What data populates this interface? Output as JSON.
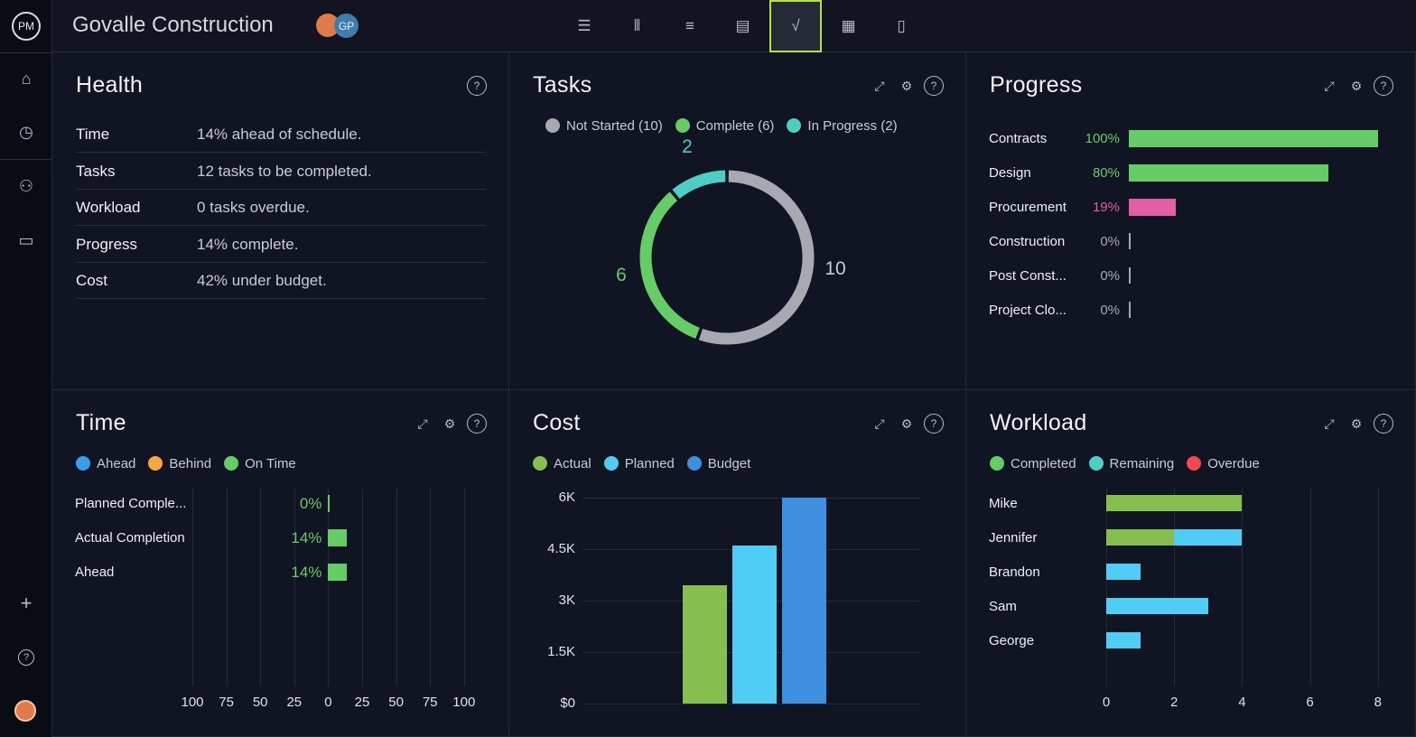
{
  "app": {
    "logo": "PM",
    "project_title": "Govalle Construction",
    "avatar_initials": "GP"
  },
  "toolbar": {
    "views": [
      {
        "icon": "list-icon"
      },
      {
        "icon": "board-icon"
      },
      {
        "icon": "gantt-icon"
      },
      {
        "icon": "sheet-icon"
      },
      {
        "icon": "dashboard-icon",
        "active": true
      },
      {
        "icon": "calendar-icon"
      },
      {
        "icon": "file-icon"
      }
    ],
    "accent": "#b4e33d"
  },
  "sidebar": {
    "items": [
      "home-icon",
      "clock-icon",
      "people-icon",
      "briefcase-icon"
    ],
    "bottom": [
      "plus-icon",
      "help-icon",
      "user-avatar"
    ]
  },
  "health": {
    "title": "Health",
    "rows": [
      {
        "label": "Time",
        "value": "14% ahead of schedule."
      },
      {
        "label": "Tasks",
        "value": "12 tasks to be completed."
      },
      {
        "label": "Workload",
        "value": "0 tasks overdue."
      },
      {
        "label": "Progress",
        "value": "14% complete."
      },
      {
        "label": "Cost",
        "value": "42% under budget."
      }
    ]
  },
  "tasks": {
    "title": "Tasks"
  },
  "progress": {
    "title": "Progress"
  },
  "time": {
    "title": "Time"
  },
  "cost": {
    "title": "Cost"
  },
  "workload": {
    "title": "Workload"
  },
  "chart_data": [
    {
      "id": "tasks",
      "type": "pie",
      "donut": true,
      "legend": [
        {
          "label": "Not Started (10)",
          "color": "#a6a9b1"
        },
        {
          "label": "Complete (6)",
          "color": "#66cc66"
        },
        {
          "label": "In Progress (2)",
          "color": "#4ecdc4"
        }
      ],
      "slices": [
        {
          "name": "Not Started",
          "value": 10,
          "label": "10",
          "color": "#a6a9b1"
        },
        {
          "name": "Complete",
          "value": 6,
          "label": "6",
          "color": "#66cc66"
        },
        {
          "name": "In Progress",
          "value": 2,
          "label": "2",
          "color": "#4ecdc4"
        }
      ]
    },
    {
      "id": "progress",
      "type": "bar",
      "orientation": "horizontal",
      "xlim": [
        0,
        100
      ],
      "categories": [
        "Contracts",
        "Design",
        "Procurement",
        "Construction",
        "Post Const...",
        "Project Clo..."
      ],
      "values": [
        100,
        80,
        19,
        0,
        0,
        0
      ],
      "value_labels": [
        "100%",
        "80%",
        "19%",
        "0%",
        "0%",
        "0%"
      ],
      "colors": [
        "#66cc66",
        "#66cc66",
        "#e35ea6",
        "#a6a9b1",
        "#a6a9b1",
        "#a6a9b1"
      ]
    },
    {
      "id": "time",
      "type": "bar",
      "orientation": "horizontal",
      "diverging": true,
      "xlim": [
        -100,
        100
      ],
      "legend": [
        {
          "label": "Ahead",
          "color": "#3b9eea"
        },
        {
          "label": "Behind",
          "color": "#f5a742"
        },
        {
          "label": "On Time",
          "color": "#66cc66"
        }
      ],
      "categories": [
        "Planned Comple...",
        "Actual Completion",
        "Ahead"
      ],
      "values": [
        0,
        14,
        14
      ],
      "value_labels": [
        "0%",
        "14%",
        "14%"
      ],
      "color": "#66cc66",
      "xticks": [
        "100",
        "75",
        "50",
        "25",
        "0",
        "25",
        "50",
        "75",
        "100"
      ],
      "grid": true
    },
    {
      "id": "cost",
      "type": "bar",
      "ylim": [
        0,
        6000
      ],
      "legend": [
        {
          "label": "Actual",
          "color": "#86bf50"
        },
        {
          "label": "Planned",
          "color": "#4fcdf5"
        },
        {
          "label": "Budget",
          "color": "#3f8fe0"
        }
      ],
      "series": [
        {
          "name": "Actual",
          "values": [
            3450
          ],
          "color": "#86bf50"
        },
        {
          "name": "Planned",
          "values": [
            4600
          ],
          "color": "#4fcdf5"
        },
        {
          "name": "Budget",
          "values": [
            6000
          ],
          "color": "#3f8fe0"
        }
      ],
      "yticks": [
        "$0",
        "1.5K",
        "3K",
        "4.5K",
        "6K"
      ],
      "grid": true
    },
    {
      "id": "workload",
      "type": "bar",
      "orientation": "horizontal",
      "stacked": true,
      "xlim": [
        0,
        8
      ],
      "legend": [
        {
          "label": "Completed",
          "color": "#66cc66"
        },
        {
          "label": "Remaining",
          "color": "#4ecdc4"
        },
        {
          "label": "Overdue",
          "color": "#f04a4a"
        }
      ],
      "categories": [
        "Mike",
        "Jennifer",
        "Brandon",
        "Sam",
        "George"
      ],
      "series": [
        {
          "name": "Completed",
          "values": [
            4,
            2,
            0,
            0,
            0
          ],
          "color": "#86bf50"
        },
        {
          "name": "Remaining",
          "values": [
            0,
            2,
            1,
            3,
            1
          ],
          "color": "#4fcdf5"
        },
        {
          "name": "Overdue",
          "values": [
            0,
            0,
            0,
            0,
            0
          ],
          "color": "#f04a4a"
        }
      ],
      "xticks": [
        "0",
        "2",
        "4",
        "6",
        "8"
      ],
      "grid": true
    }
  ]
}
